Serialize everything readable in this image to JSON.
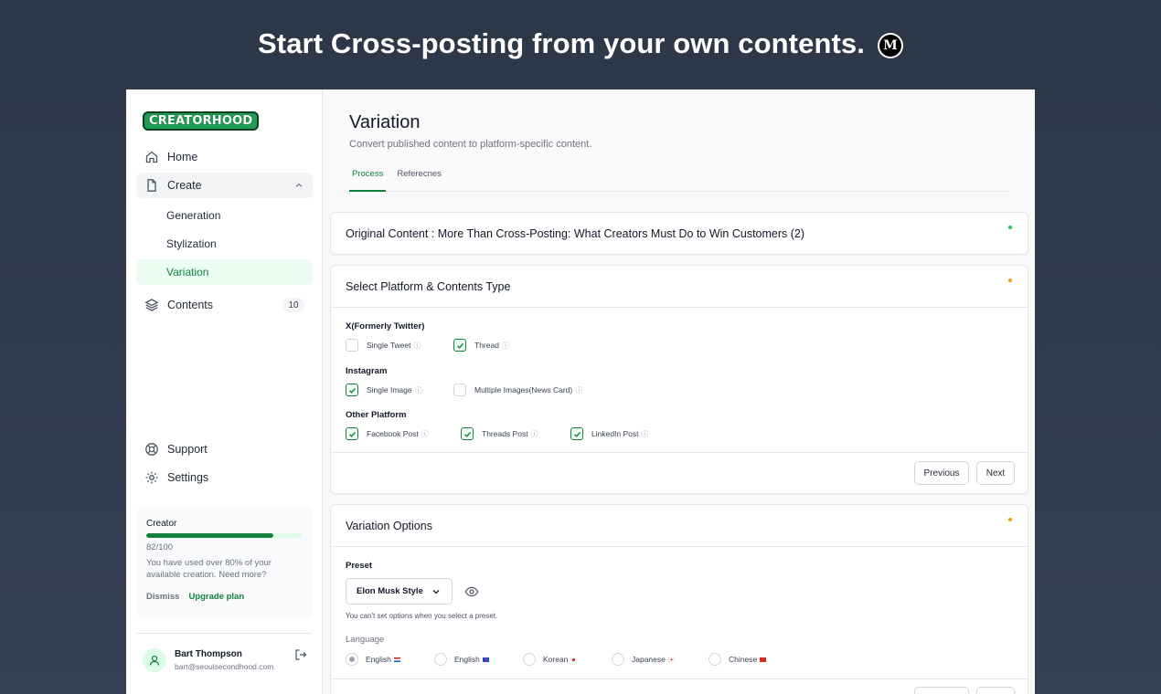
{
  "hero": {
    "title": "Start Cross-posting from your own contents.",
    "logo_letter": "M"
  },
  "sidebar": {
    "logo": "CREATORHOOD",
    "nav": {
      "home": "Home",
      "create": "Create",
      "generation": "Generation",
      "stylization": "Stylization",
      "variation": "Variation",
      "contents": "Contents",
      "contents_count": "10",
      "support": "Support",
      "settings": "Settings"
    },
    "usage": {
      "plan": "Creator",
      "progress": 0.82,
      "count": "82/100",
      "message": "You have used over 80% of your available creation. Need more?",
      "dismiss": "Dismiss",
      "upgrade": "Upgrade plan"
    },
    "user": {
      "name": "Bart Thompson",
      "email": "bart@seoulsecondhood.com"
    }
  },
  "page": {
    "title": "Variation",
    "subtitle": "Convert published content to platform-specific content.",
    "tabs": [
      "Process",
      "Referecnes"
    ]
  },
  "original": {
    "title": "Original Content : More Than Cross-Posting: What Creators Must Do to Win Customers (2)",
    "status_color": "#22c55e"
  },
  "platform": {
    "title": "Select Platform & Contents Type",
    "status_color": "#f59e0b",
    "x_label": "X(Formerly Twitter)",
    "single_tweet": "Single Tweet",
    "thread": "Thread",
    "instagram_label": "Instagram",
    "single_image": "Single Image",
    "multiple_images": "Multiple Images(News Card)",
    "other_label": "Other Platform",
    "facebook": "Facebook Post",
    "threads": "Threads Post",
    "linkedin": "LinkedIn Post",
    "previous": "Previous",
    "next": "Next"
  },
  "options": {
    "title": "Variation Options",
    "status_color": "#f59e0b",
    "preset_label": "Preset",
    "preset_value": "Elon Musk Style",
    "hint": "You can't set options when you select a preset.",
    "language_label": "Language",
    "languages": [
      "English",
      "English",
      "Korean",
      "Japanese",
      "Chinese"
    ]
  },
  "colors": {
    "accent": "#15803d",
    "accent_light": "#ecfdf3"
  }
}
